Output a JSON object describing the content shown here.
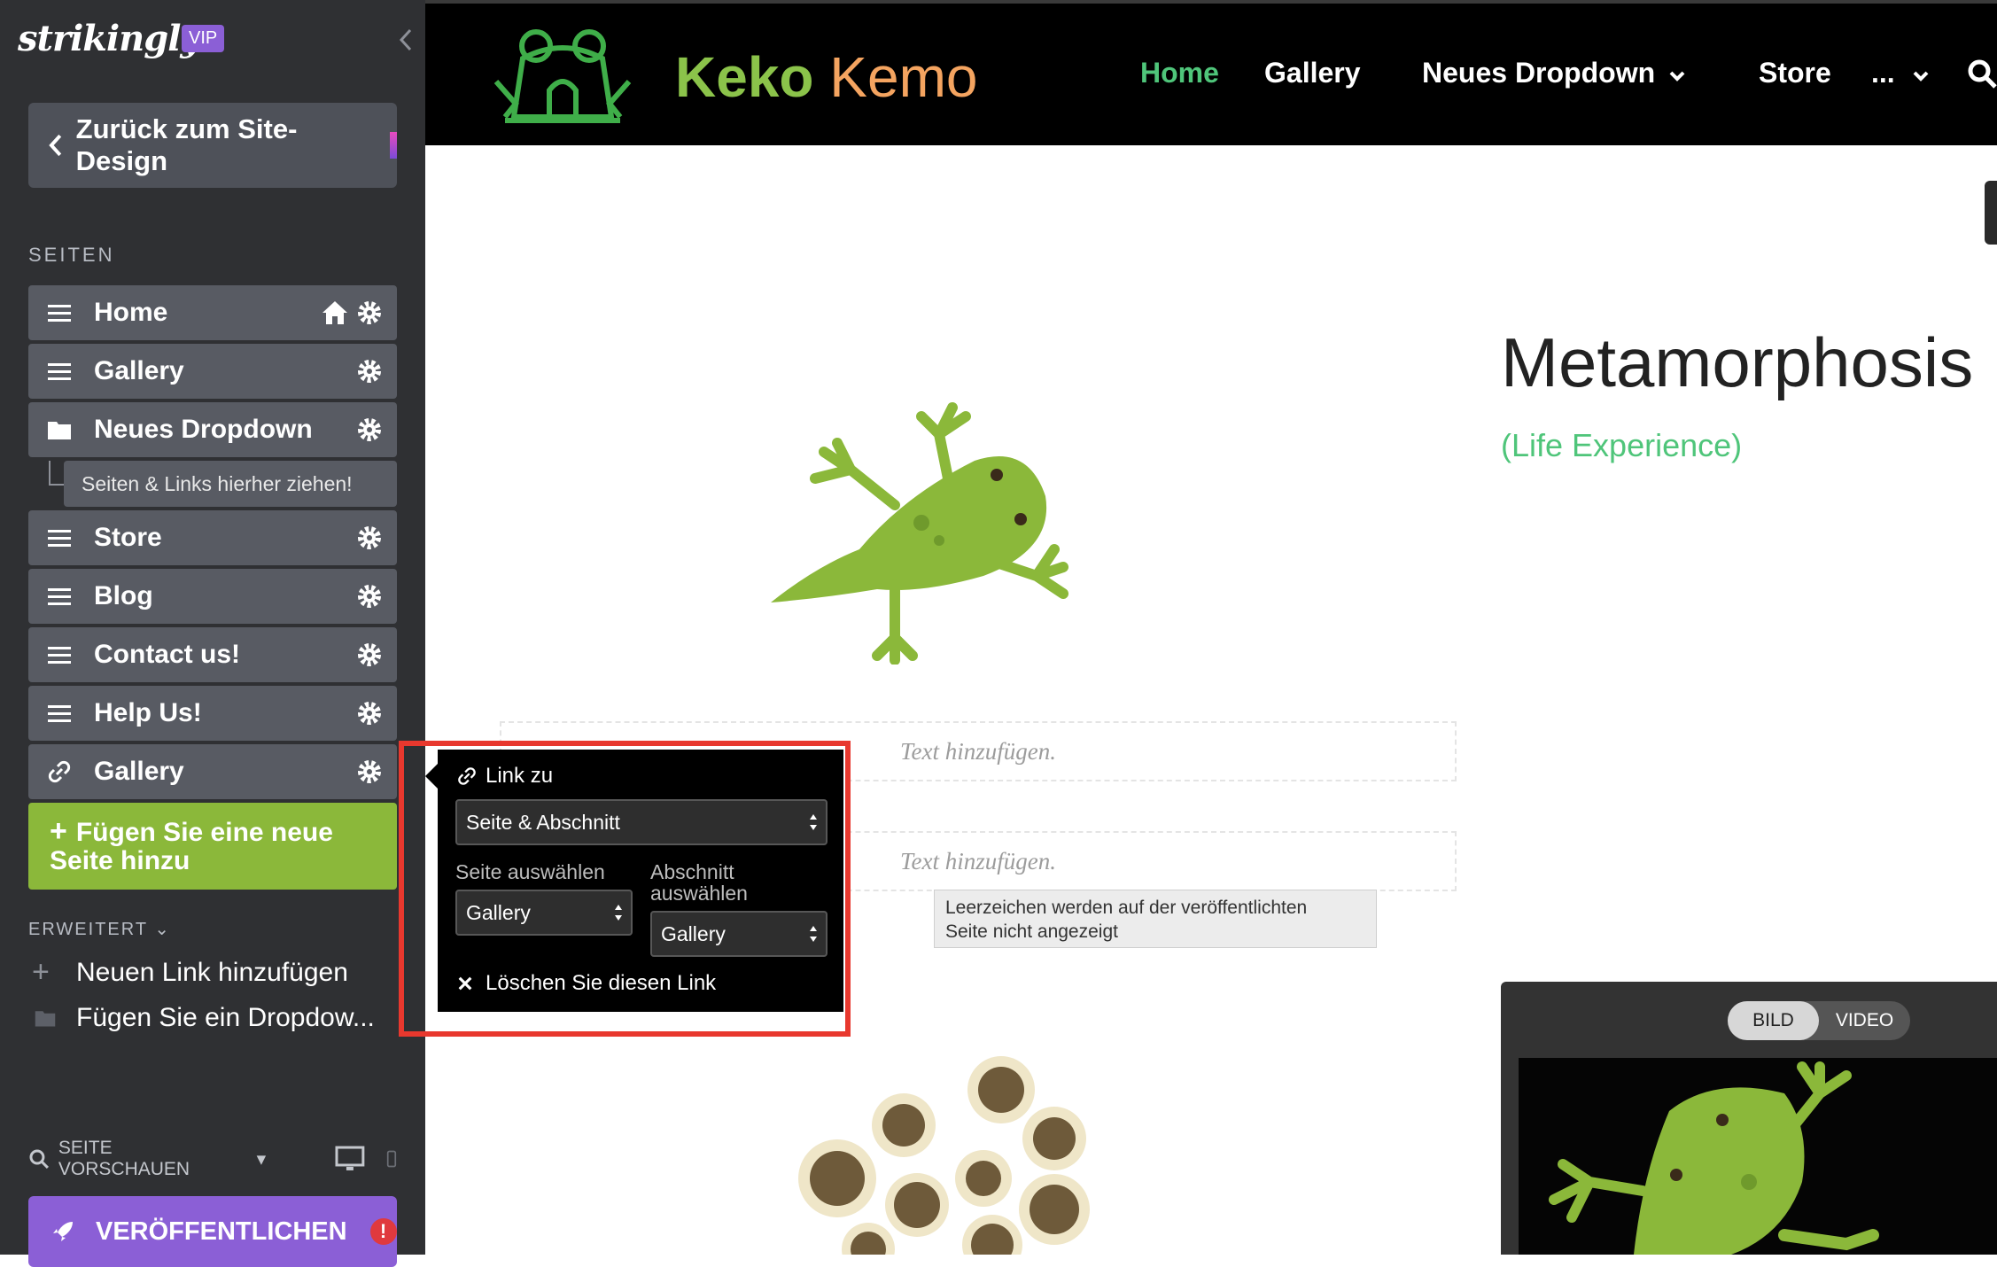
{
  "sidebar": {
    "logo": "strikingly",
    "vip": "VIP",
    "back_label": "Zurück zum Site-Design",
    "pages_heading": "SEITEN",
    "pages": [
      {
        "label": "Home",
        "icon": "menu-icon",
        "home": true
      },
      {
        "label": "Gallery",
        "icon": "menu-icon"
      },
      {
        "label": "Neues Dropdown",
        "icon": "folder-icon"
      },
      {
        "label": "Store",
        "icon": "menu-icon"
      },
      {
        "label": "Blog",
        "icon": "menu-icon"
      },
      {
        "label": "Contact us!",
        "icon": "menu-icon"
      },
      {
        "label": "Help Us!",
        "icon": "menu-icon"
      },
      {
        "label": "Gallery",
        "icon": "link-icon"
      }
    ],
    "drop_hint": "Seiten & Links hierher ziehen!",
    "add_page_line1": "Fügen Sie eine neue",
    "add_page_line2": "Seite hinzu",
    "advanced_heading": "ERWEITERT",
    "add_link": "Neuen Link hinzufügen",
    "add_dropdown": "Fügen Sie ein Dropdow...",
    "preview_label": "SEITE VORSCHAUEN",
    "publish_label": "VERÖFFENTLICHEN",
    "publish_alert": "!"
  },
  "site": {
    "brand_part1": "Keko",
    "brand_part2": "Kemo",
    "nav": [
      "Home",
      "Gallery",
      "Neues Dropdown",
      "Store",
      "..."
    ],
    "accent_color": "#4fc57a"
  },
  "content": {
    "title": "Metamorphosis",
    "subtitle": "(Life Experience)",
    "placeholder_1": "Text hinzufügen.",
    "placeholder_2": "Text hinzufügen.",
    "tooltip_line1": "Leerzeichen werden auf der veröffentlichten",
    "tooltip_line2": "Seite nicht angezeigt",
    "media_tabs": [
      "BILD",
      "VIDEO"
    ]
  },
  "link_popover": {
    "title": "Link zu",
    "link_type": "Seite & Abschnitt",
    "page_label": "Seite auswählen",
    "page_value": "Gallery",
    "section_label_line1": "Abschnitt",
    "section_label_line2": "auswählen",
    "section_value": "Gallery",
    "delete_label": "Löschen Sie diesen Link"
  }
}
